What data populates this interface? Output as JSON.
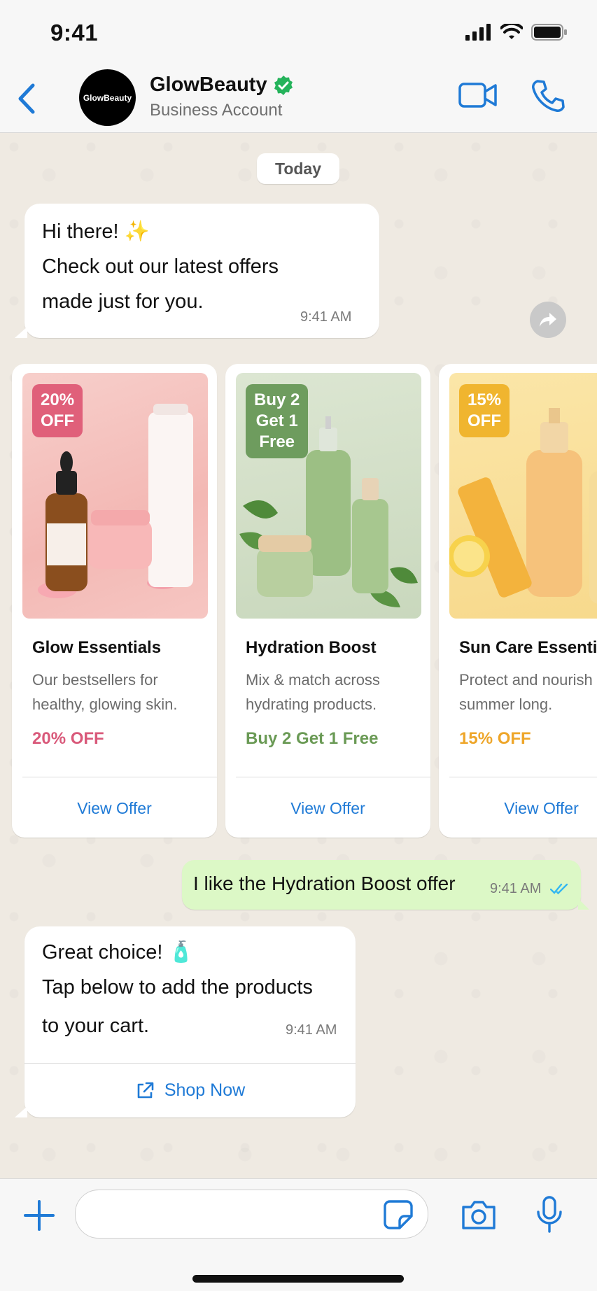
{
  "status": {
    "time": "9:41"
  },
  "header": {
    "back_label": "Back",
    "avatar_text": "GlowBeauty",
    "name": "GlowBeauty",
    "subtitle": "Business Account",
    "verified": true,
    "accent": "#1f7ad6"
  },
  "chat": {
    "date": "Today",
    "messages": [
      {
        "direction": "incoming",
        "lines": [
          "Hi there! ✨",
          "Check out our latest offers",
          "made just for you."
        ],
        "time": "9:41 AM"
      },
      {
        "direction": "outgoing",
        "text": "I like the Hydration Boost offer",
        "time": "9:41 AM",
        "status": "read"
      },
      {
        "direction": "incoming",
        "lines": [
          "Great choice! 🧴",
          "Tap below to add the products",
          "to your cart."
        ],
        "time": "9:41 AM",
        "action_label": "Shop Now"
      }
    ],
    "carousel": [
      {
        "badge": "20% OFF",
        "badge_lines": [
          "20%",
          "OFF"
        ],
        "badge_color": "#e0607a",
        "title": "Glow Essentials",
        "desc": "Our bestsellers for healthy, glowing skin.",
        "offer": "20% OFF",
        "offer_color": "#d9597a",
        "action": "View Offer"
      },
      {
        "badge": "Buy 2 Get 1 Free",
        "badge_lines": [
          "Buy 2",
          "Get 1",
          "Free"
        ],
        "badge_color": "#6e9c5e",
        "title": "Hydration Boost",
        "desc": "Mix & match across hydrating products.",
        "offer": "Buy 2 Get 1 Free",
        "offer_color": "#6a9a55",
        "action": "View Offer"
      },
      {
        "badge": "15% OFF",
        "badge_lines": [
          "15%",
          "OFF"
        ],
        "badge_color": "#f0b52f",
        "title": "Sun Care Essentials",
        "desc": "Protect and nourish all summer long.",
        "offer": "15% OFF",
        "offer_color": "#eea62a",
        "action": "View Offer"
      }
    ]
  },
  "input": {
    "placeholder": ""
  },
  "icons": [
    "back-icon",
    "verified-icon",
    "video-icon",
    "phone-icon",
    "forward-icon",
    "external-link-icon",
    "plus-icon",
    "sticker-icon",
    "camera-icon",
    "mic-icon",
    "double-check-icon"
  ]
}
